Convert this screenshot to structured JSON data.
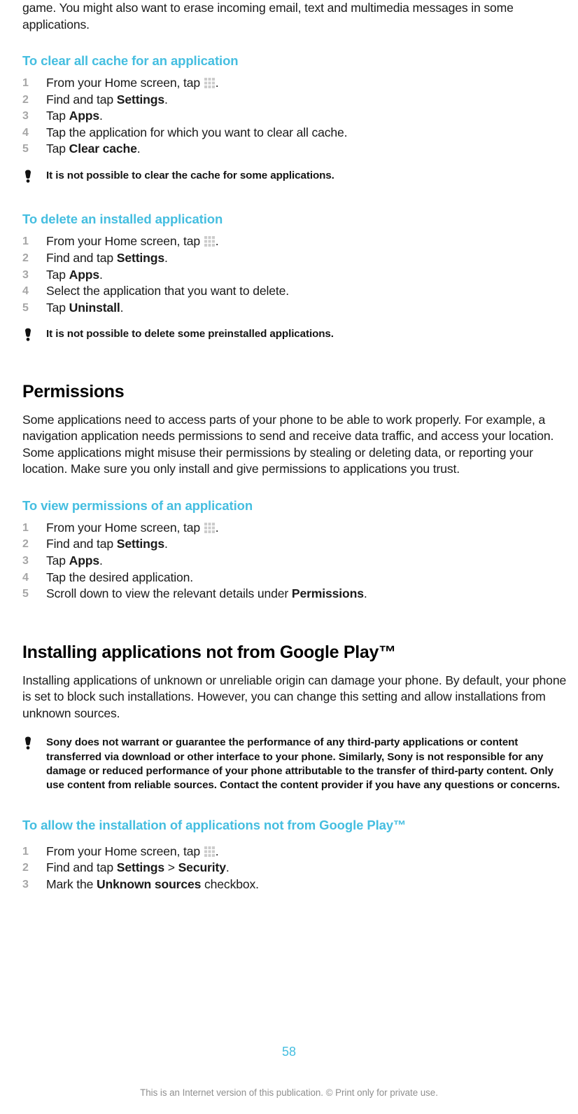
{
  "colors": {
    "heading_blue": "#45bee0",
    "step_number_gray": "#a6a6a6",
    "body_black": "#1a1a1a",
    "footer_gray": "#8f8f8f",
    "grid_icon_gray": "#cccccc"
  },
  "intro": {
    "continued_paragraph": "game. You might also want to erase incoming email, text and multimedia messages in some applications."
  },
  "sections": [
    {
      "id": "clear-all-cache",
      "heading": "To clear all cache for an application",
      "steps": [
        {
          "pre": "From your Home screen, tap ",
          "icon": "apps-grid-icon",
          "post": "."
        },
        {
          "pre": "Find and tap ",
          "bold": "Settings",
          "post": "."
        },
        {
          "pre": "Tap ",
          "bold": "Apps",
          "post": "."
        },
        {
          "pre": "Tap the application for which you want to clear all cache."
        },
        {
          "pre": "Tap ",
          "bold": "Clear cache",
          "post": "."
        }
      ],
      "note": "It is not possible to clear the cache for some applications."
    },
    {
      "id": "delete-installed-application",
      "heading": "To delete an installed application",
      "steps": [
        {
          "pre": "From your Home screen, tap ",
          "icon": "apps-grid-icon",
          "post": "."
        },
        {
          "pre": "Find and tap ",
          "bold": "Settings",
          "post": "."
        },
        {
          "pre": "Tap ",
          "bold": "Apps",
          "post": "."
        },
        {
          "pre": "Select the application that you want to delete."
        },
        {
          "pre": "Tap ",
          "bold": "Uninstall",
          "post": "."
        }
      ],
      "note": "It is not possible to delete some preinstalled applications."
    }
  ],
  "permissions": {
    "title": "Permissions",
    "paragraph": "Some applications need to access parts of your phone to be able to work properly. For example, a navigation application needs permissions to send and receive data traffic, and access your location. Some applications might misuse their permissions by stealing or deleting data, or reporting your location. Make sure you only install and give permissions to applications you trust.",
    "procedure": {
      "heading": "To view permissions of an application",
      "steps": [
        {
          "pre": "From your Home screen, tap ",
          "icon": "apps-grid-icon",
          "post": "."
        },
        {
          "pre": "Find and tap ",
          "bold": "Settings",
          "post": "."
        },
        {
          "pre": "Tap ",
          "bold": "Apps",
          "post": "."
        },
        {
          "pre": "Tap the desired application."
        },
        {
          "pre": "Scroll down to view the relevant details under ",
          "bold": "Permissions",
          "post": "."
        }
      ]
    }
  },
  "installing": {
    "title": "Installing applications not from Google Play™",
    "paragraph": "Installing applications of unknown or unreliable origin can damage your phone. By default, your phone is set to block such installations. However, you can change this setting and allow installations from unknown sources.",
    "note": "Sony does not warrant or guarantee the performance of any third-party applications or content transferred via download or other interface to your phone. Similarly, Sony is not responsible for any damage or reduced performance of your phone attributable to the transfer of third-party content. Only use content from reliable sources. Contact the content provider if you have any questions or concerns.",
    "procedure": {
      "heading": "To allow the installation of applications not from Google Play™",
      "steps": [
        {
          "pre": "From your Home screen, tap ",
          "icon": "apps-grid-icon",
          "post": "."
        },
        {
          "pre": "Find and tap ",
          "bold": "Settings",
          "mid": " > ",
          "bold2": "Security",
          "post": "."
        },
        {
          "pre": "Mark the ",
          "bold": "Unknown sources",
          "post": " checkbox."
        }
      ]
    }
  },
  "footer": {
    "page_number": "58",
    "disclaimer": "This is an Internet version of this publication. © Print only for private use."
  }
}
